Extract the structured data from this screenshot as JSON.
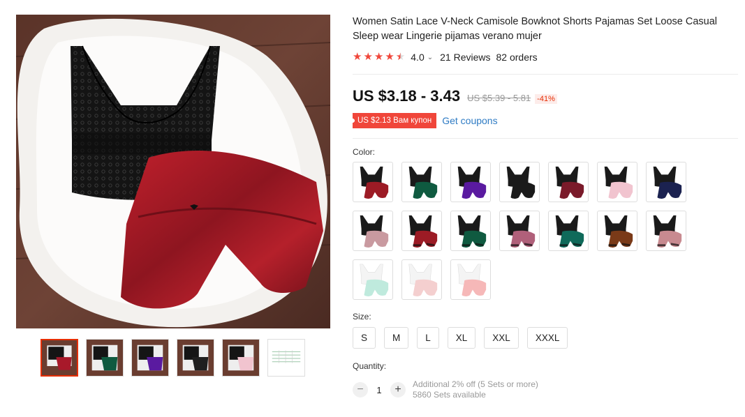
{
  "product": {
    "title": "Women Satin Lace V-Neck Camisole Bowknot Shorts Pajamas Set Loose Casual Sleep wear Lingerie pijamas verano mujer",
    "rating": {
      "stars": 4.5,
      "value": "4.0",
      "reviews": "21 Reviews",
      "orders": "82 orders"
    },
    "price": {
      "current": "US $3.18 - 3.43",
      "original": "US $5.39 - 5.81",
      "discount": "-41%"
    },
    "coupon": {
      "tag": "US $2.13 Вам купон",
      "link": "Get coupons"
    },
    "color": {
      "label": "Color:",
      "options": [
        "red",
        "green",
        "purple",
        "black",
        "wine",
        "pink",
        "navy",
        "dusty-pink",
        "red-lace",
        "green-lace",
        "mauve-lace",
        "teal-lace",
        "brown-lace",
        "rose-lace",
        "white-mint",
        "white-pink",
        "white-peach"
      ]
    },
    "size": {
      "label": "Size:",
      "options": [
        "S",
        "M",
        "L",
        "XL",
        "XXL",
        "XXXL"
      ]
    },
    "quantity": {
      "label": "Quantity:",
      "value": "1",
      "minus": "−",
      "plus": "+",
      "promo": "Additional 2% off (5 Sets or more)",
      "available": "5860 Sets available"
    }
  },
  "colors": {
    "accent": "#f0463a",
    "link": "#2e7bc4",
    "red": "#9c1b25",
    "green": "#0f5a40",
    "purple": "#5a1aa0",
    "black": "#1a1a1a",
    "wine": "#7a1a2a",
    "pink": "#f1c4cf",
    "navy": "#1b2250",
    "dusty": "#c99aa0",
    "mauve": "#b0607a",
    "teal": "#0f6a5a",
    "brown": "#7a3a18",
    "rose": "#c88a90",
    "mint": "#bfeadd",
    "blush": "#f4cfcf",
    "peach": "#f6b8b8"
  },
  "gallery": {
    "main": "red",
    "thumbs": [
      "red",
      "green",
      "purple",
      "black",
      "pink",
      "size-chart"
    ]
  }
}
